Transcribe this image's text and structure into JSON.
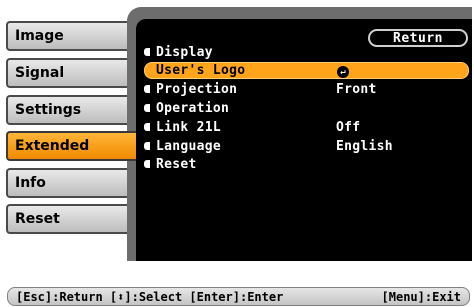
{
  "sidebar": {
    "tabs": [
      {
        "label": "Image"
      },
      {
        "label": "Signal"
      },
      {
        "label": "Settings"
      },
      {
        "label": "Extended",
        "active": true
      },
      {
        "label": "Info"
      },
      {
        "label": "Reset"
      }
    ]
  },
  "panel": {
    "return_label": "Return",
    "items": [
      {
        "label": "Display",
        "value": ""
      },
      {
        "label": "User's Logo",
        "value_icon": "enter-icon"
      },
      {
        "label": "Projection",
        "value": "Front"
      },
      {
        "label": "Operation",
        "value": ""
      },
      {
        "label": "Link 21L",
        "value": "Off"
      },
      {
        "label": "Language",
        "value": "English"
      },
      {
        "label": "Reset",
        "value": ""
      }
    ]
  },
  "footer": {
    "left": "[Esc]:Return [⬍]:Select [Enter]:Enter",
    "right": "[Menu]:Exit"
  },
  "colors": {
    "accent": "#F39200",
    "panel_bg": "#000000",
    "panel_frame": "#6D6D6D"
  }
}
